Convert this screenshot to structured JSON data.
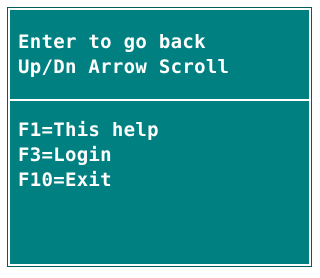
{
  "help_panel": {
    "instructions": [
      "Enter to go back",
      "Up/Dn Arrow Scroll"
    ],
    "keys": [
      "F1=This help",
      "F3=Login",
      "F10=Exit"
    ],
    "colors": {
      "background": "#008080",
      "text": "#ffffff",
      "border": "#ffffff"
    }
  }
}
